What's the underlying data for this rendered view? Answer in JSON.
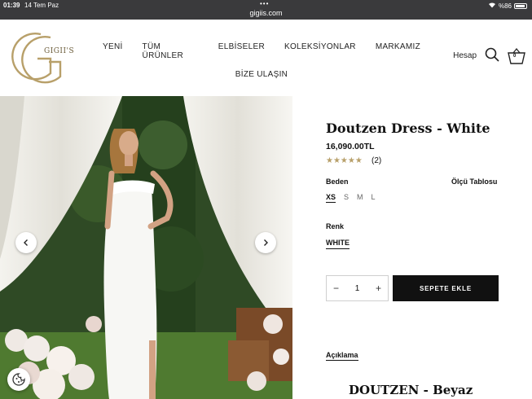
{
  "status_bar": {
    "time": "01:39",
    "date": "14 Tem Paz",
    "url": "gigiis.com",
    "battery": "%86"
  },
  "brand": {
    "logo_text": "GIGII'S",
    "accent": "#b8a06a"
  },
  "nav": {
    "row1": [
      "YENİ",
      "TÜM ÜRÜNLER",
      "ELBİSELER",
      "KOLEKSİYONLAR",
      "MARKAMIZ"
    ],
    "row2": [
      "BİZE ULAŞIN"
    ]
  },
  "header": {
    "account": "Hesap",
    "cart_count": "0"
  },
  "product": {
    "title": "Doutzen Dress - White",
    "price": "16,090.00TL",
    "rating_stars": "★★★★★",
    "rating_value": 5,
    "reviews": "(2)",
    "size_label": "Beden",
    "size_guide": "Ölçü Tablosu",
    "sizes": [
      "XS",
      "S",
      "M",
      "L"
    ],
    "selected_size": "XS",
    "color_label": "Renk",
    "color": "WHITE",
    "quantity": "1",
    "add_to_cart": "SEPETE EKLE",
    "description_tab": "Açıklama",
    "description_title": "DOUTZEN - Beyaz"
  }
}
